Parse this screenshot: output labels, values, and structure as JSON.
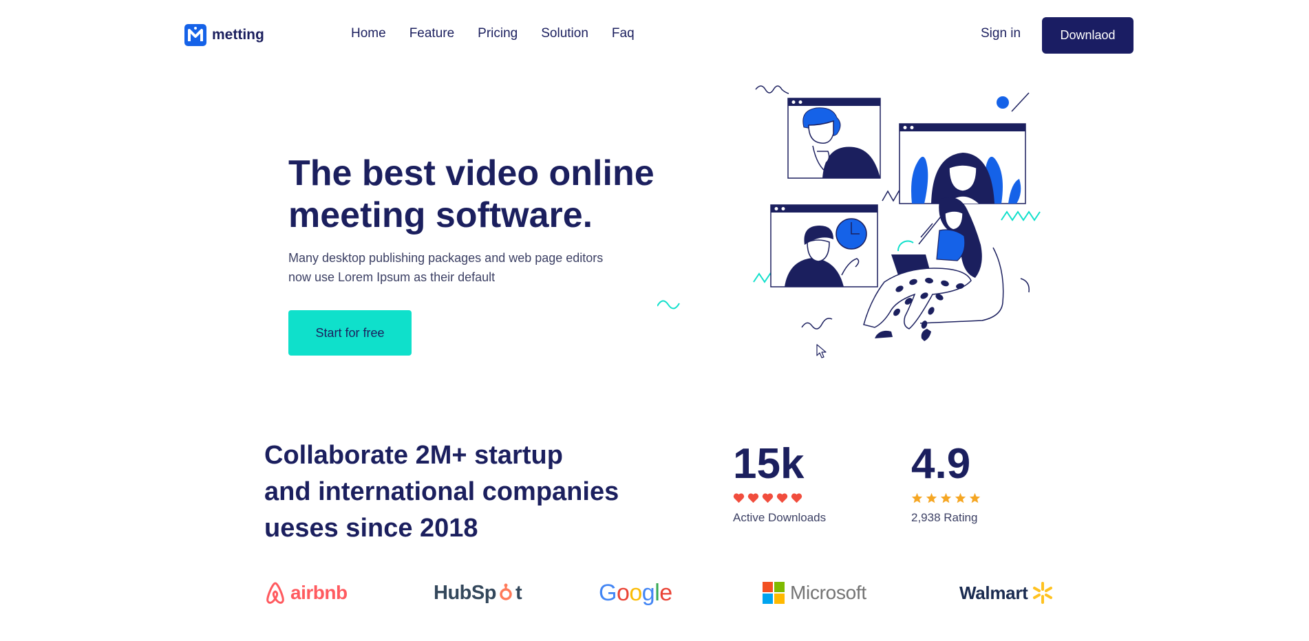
{
  "brand": {
    "name": "metting",
    "logo_letter": "M",
    "color": "#1562e8"
  },
  "nav": {
    "items": [
      "Home",
      "Feature",
      "Pricing",
      "Solution",
      "Faq"
    ],
    "sign_in": "Sign in",
    "download": "Downlaod"
  },
  "hero": {
    "title_line1": "The best video online",
    "title_line2": "meeting software.",
    "subtitle_line1": "Many desktop publishing packages and web page editors",
    "subtitle_line2": "now use Lorem Ipsum as their default",
    "cta": "Start for free"
  },
  "stats": {
    "heading_line1": "Collaborate 2M+ startup",
    "heading_line2": "and international companies",
    "heading_line3": "ueses since 2018",
    "downloads": {
      "value": "15k",
      "label": "Active Downloads",
      "icon": "heart-icon",
      "icon_count": 5,
      "color": "#f14d3d"
    },
    "rating": {
      "value": "4.9",
      "label": "2,938 Rating",
      "icon": "star-icon",
      "icon_count": 5,
      "color": "#f5a623"
    }
  },
  "partners": {
    "airbnb": "airbnb",
    "hubspot_pre": "HubSp",
    "hubspot_post": "t",
    "google_letters": [
      "G",
      "o",
      "o",
      "g",
      "l",
      "e"
    ],
    "google_colors": [
      "#4285f4",
      "#ea4335",
      "#fbbc05",
      "#4285f4",
      "#34a853",
      "#ea4335"
    ],
    "microsoft": "Microsoft",
    "walmart": "Walmart"
  },
  "colors": {
    "navy": "#1b1f5e",
    "button_navy": "#1a1d63",
    "teal": "#0fe0cb",
    "blue": "#1562e8"
  }
}
